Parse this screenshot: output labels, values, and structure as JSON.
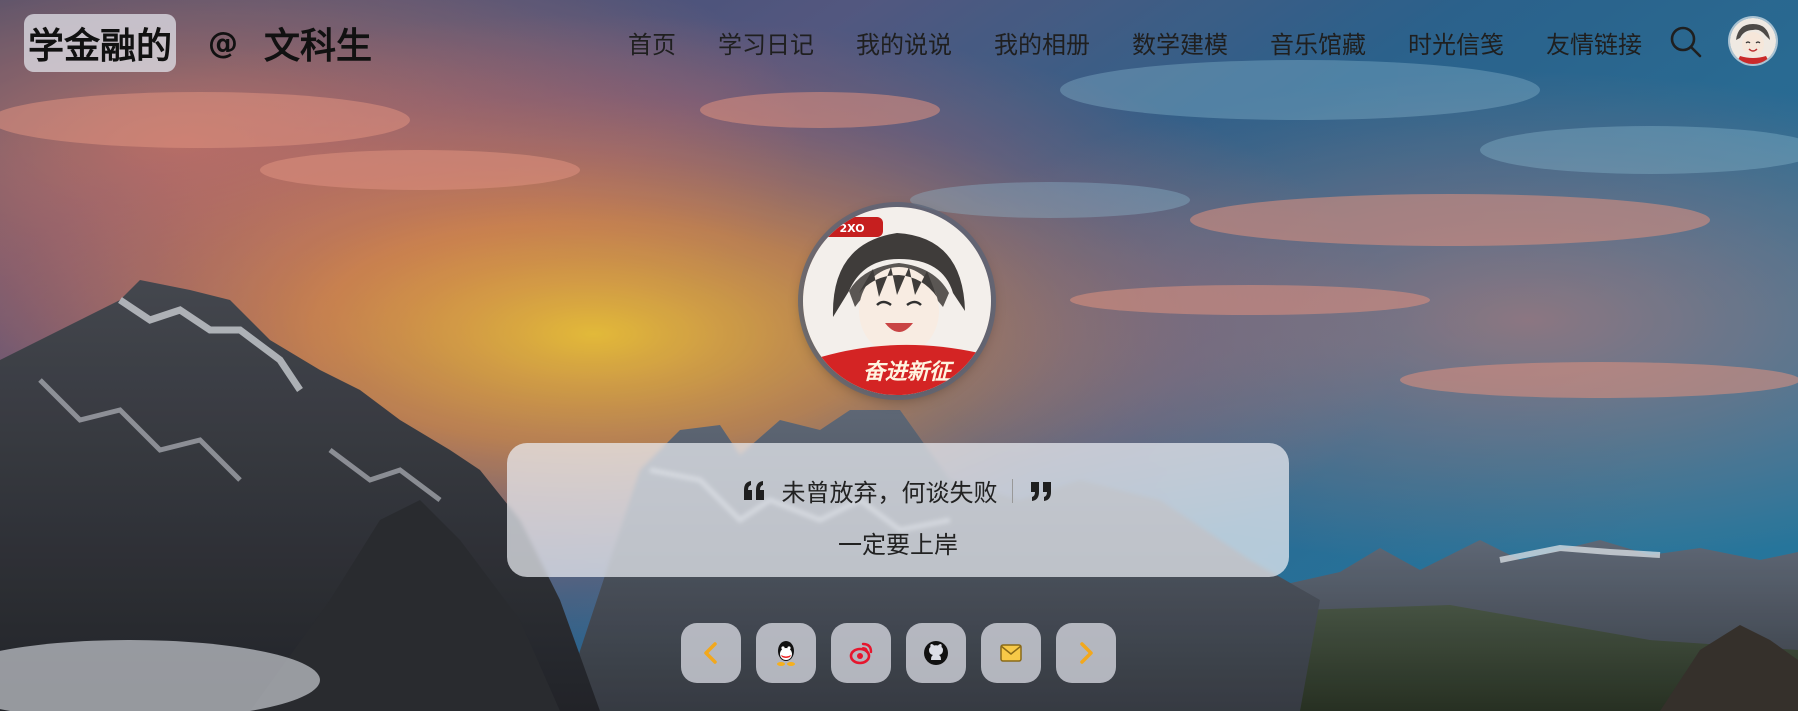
{
  "brand": {
    "name": "学金融的",
    "at": "@",
    "suffix": "文科生"
  },
  "nav": {
    "items": [
      {
        "label": "首页"
      },
      {
        "label": "学习日记"
      },
      {
        "label": "我的说说"
      },
      {
        "label": "我的相册"
      },
      {
        "label": "数学建模"
      },
      {
        "label": "音乐馆藏"
      },
      {
        "label": "时光信笺"
      },
      {
        "label": "友情链接"
      }
    ],
    "search_icon": "search-icon",
    "avatar_icon": "user-avatar"
  },
  "hero": {
    "avatar_badge_text": "2XO",
    "avatar_banner_text": "奋进新征",
    "quote": "未曾放弃，何谈失败",
    "sub_quote": "一定要上岸"
  },
  "social": {
    "buttons": [
      {
        "icon": "chevron-left-icon"
      },
      {
        "icon": "qq-icon"
      },
      {
        "icon": "weibo-icon"
      },
      {
        "icon": "github-icon"
      },
      {
        "icon": "mail-icon"
      },
      {
        "icon": "chevron-right-icon"
      }
    ]
  },
  "colors": {
    "accent": "#f2a81d",
    "quote_card": "#ebeef4",
    "text": "#222222"
  }
}
